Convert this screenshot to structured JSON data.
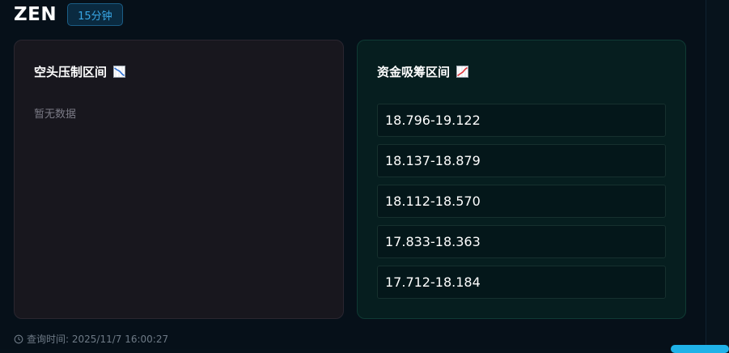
{
  "header": {
    "symbol": "ZEN",
    "timeframe": "15分钟"
  },
  "short_pressure": {
    "title": "空头压制区间",
    "icon": "chart-decreasing-icon",
    "empty_text": "暂无数据"
  },
  "accumulation": {
    "title": "资金吸筹区间",
    "icon": "chart-increasing-icon",
    "zones": [
      "18.796-19.122",
      "18.137-18.879",
      "18.112-18.570",
      "17.833-18.363",
      "17.712-18.184"
    ]
  },
  "footer": {
    "query_time": "查询时间: 2025/11/7 16:00:27"
  },
  "colors": {
    "accent": "#39a7e6",
    "short_panel_bg": "#18171e",
    "accumulation_panel_bg": "#061e1f"
  }
}
